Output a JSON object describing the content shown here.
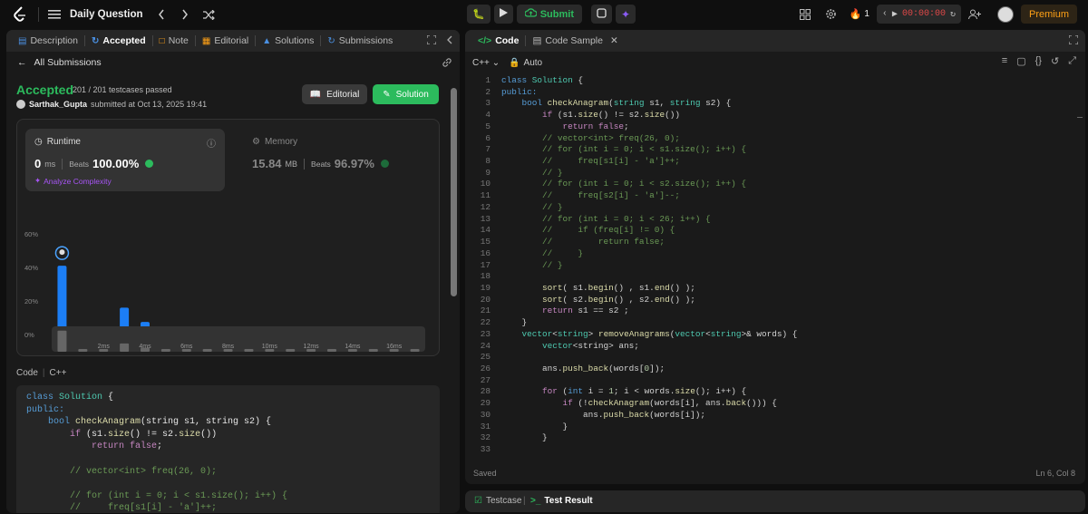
{
  "topbar": {
    "title": "Daily Question",
    "submit": "Submit",
    "streak": "1",
    "timer": "00:00:00",
    "premium": "Premium"
  },
  "left_tabs": [
    {
      "label": "Description",
      "icon": "description-icon",
      "active": false
    },
    {
      "label": "Accepted",
      "icon": "history-icon",
      "active": true
    },
    {
      "label": "Note",
      "icon": "note-icon",
      "active": false
    },
    {
      "label": "Editorial",
      "icon": "book-icon",
      "active": false
    },
    {
      "label": "Solutions",
      "icon": "flask-icon",
      "active": false
    },
    {
      "label": "Submissions",
      "icon": "history-icon",
      "active": false
    }
  ],
  "submission": {
    "back_label": "All Submissions",
    "status": "Accepted",
    "testcases": "201 / 201 testcases passed",
    "user": "Sarthak_Gupta",
    "submitted_at": "submitted at Oct 13, 2025 19:41",
    "editorial_btn": "Editorial",
    "solution_btn": "Solution"
  },
  "runtime": {
    "title": "Runtime",
    "value": "0",
    "unit": "ms",
    "beats_label": "Beats",
    "beats": "100.00%",
    "analyze": "Analyze Complexity"
  },
  "memory": {
    "title": "Memory",
    "value": "15.84",
    "unit": "MB",
    "beats_label": "Beats",
    "beats": "96.97%"
  },
  "chart_data": {
    "type": "bar",
    "title": "",
    "xlabel": "",
    "ylabel": "",
    "ylim": [
      0,
      60
    ],
    "y_ticks": [
      "0%",
      "20%",
      "40%",
      "60%"
    ],
    "x_ticks": [
      "2ms",
      "4ms",
      "6ms",
      "8ms",
      "10ms",
      "12ms",
      "14ms",
      "16ms"
    ],
    "categories": [
      "0ms",
      "1ms",
      "2ms",
      "3ms",
      "4ms",
      "5ms",
      "6ms",
      "7ms",
      "8ms",
      "9ms",
      "10ms",
      "11ms",
      "12ms",
      "13ms",
      "14ms",
      "15ms",
      "16ms",
      "17ms"
    ],
    "values": [
      41,
      4,
      4.5,
      16,
      7.5,
      2,
      2.5,
      4.5,
      1.5,
      1.5,
      1.5,
      1.5,
      1.5,
      1.5,
      1.5,
      1.5,
      1.5,
      1.5
    ],
    "highlight_index": 0,
    "bar_color": "#1c7ef5"
  },
  "code_label": "Code",
  "code_lang": "C++",
  "left_code": [
    [
      {
        "t": "class ",
        "c": "kw"
      },
      {
        "t": "Solution",
        "c": "ty"
      },
      {
        "t": " {",
        "c": ""
      }
    ],
    [
      {
        "t": "public:",
        "c": "kw"
      }
    ],
    [
      {
        "t": "    bool ",
        "c": "kw"
      },
      {
        "t": "checkAnagram",
        "c": "fn"
      },
      {
        "t": "(string s1, string s2) {",
        "c": ""
      }
    ],
    [
      {
        "t": "        if ",
        "c": "cy"
      },
      {
        "t": "(s1.",
        "c": ""
      },
      {
        "t": "size",
        "c": "fn"
      },
      {
        "t": "() != s2.",
        "c": ""
      },
      {
        "t": "size",
        "c": "fn"
      },
      {
        "t": "())",
        "c": ""
      }
    ],
    [
      {
        "t": "            return false",
        "c": "cy"
      },
      {
        "t": ";",
        "c": ""
      }
    ],
    [
      {
        "t": "",
        "c": ""
      }
    ],
    [
      {
        "t": "        // vector<int> freq(26, 0);",
        "c": "cm"
      }
    ],
    [
      {
        "t": "",
        "c": ""
      }
    ],
    [
      {
        "t": "        // for (int i = 0; i < s1.size(); i++) {",
        "c": "cm"
      }
    ],
    [
      {
        "t": "        //     freq[s1[i] - 'a']++;",
        "c": "cm"
      }
    ]
  ],
  "editor": {
    "tab_code": "Code",
    "tab_sample": "Code Sample",
    "lang": "C++",
    "mode": "Auto",
    "saved": "Saved",
    "cursor": "Ln 6, Col 8",
    "lines": [
      [
        {
          "t": "class ",
          "c": "kw"
        },
        {
          "t": "Solution",
          "c": "ty"
        },
        {
          "t": " {",
          "c": ""
        }
      ],
      [
        {
          "t": "public:",
          "c": "kw"
        }
      ],
      [
        {
          "t": "    bool ",
          "c": "kw"
        },
        {
          "t": "checkAnagram",
          "c": "fn"
        },
        {
          "t": "(",
          "c": ""
        },
        {
          "t": "string",
          "c": "ty"
        },
        {
          "t": " s1, ",
          "c": ""
        },
        {
          "t": "string",
          "c": "ty"
        },
        {
          "t": " s2) {",
          "c": ""
        }
      ],
      [
        {
          "t": "        if ",
          "c": "cy"
        },
        {
          "t": "(s1.",
          "c": ""
        },
        {
          "t": "size",
          "c": "fn"
        },
        {
          "t": "() != s2.",
          "c": ""
        },
        {
          "t": "size",
          "c": "fn"
        },
        {
          "t": "())",
          "c": ""
        }
      ],
      [
        {
          "t": "            return false",
          "c": "cy"
        },
        {
          "t": ";",
          "c": ""
        }
      ],
      [
        {
          "t": "        // vector<int> freq(26, 0);",
          "c": "cm"
        }
      ],
      [
        {
          "t": "        // for (int i = 0; i < s1.size(); i++) {",
          "c": "cm"
        }
      ],
      [
        {
          "t": "        //     freq[s1[i] - 'a']++;",
          "c": "cm"
        }
      ],
      [
        {
          "t": "        // }",
          "c": "cm"
        }
      ],
      [
        {
          "t": "        // for (int i = 0; i < s2.size(); i++) {",
          "c": "cm"
        }
      ],
      [
        {
          "t": "        //     freq[s2[i] - 'a']--;",
          "c": "cm"
        }
      ],
      [
        {
          "t": "        // }",
          "c": "cm"
        }
      ],
      [
        {
          "t": "        // for (int i = 0; i < 26; i++) {",
          "c": "cm"
        }
      ],
      [
        {
          "t": "        //     if (freq[i] != 0) {",
          "c": "cm"
        }
      ],
      [
        {
          "t": "        //         return false;",
          "c": "cm"
        }
      ],
      [
        {
          "t": "        //     }",
          "c": "cm"
        }
      ],
      [
        {
          "t": "        // }",
          "c": "cm"
        }
      ],
      [
        {
          "t": "",
          "c": ""
        }
      ],
      [
        {
          "t": "        sort",
          "c": "fn"
        },
        {
          "t": "( s1.",
          "c": ""
        },
        {
          "t": "begin",
          "c": "fn"
        },
        {
          "t": "() , s1.",
          "c": ""
        },
        {
          "t": "end",
          "c": "fn"
        },
        {
          "t": "() );",
          "c": ""
        }
      ],
      [
        {
          "t": "        sort",
          "c": "fn"
        },
        {
          "t": "( s2.",
          "c": ""
        },
        {
          "t": "begin",
          "c": "fn"
        },
        {
          "t": "() , s2.",
          "c": ""
        },
        {
          "t": "end",
          "c": "fn"
        },
        {
          "t": "() );",
          "c": ""
        }
      ],
      [
        {
          "t": "        return ",
          "c": "cy"
        },
        {
          "t": "s1 == s2 ;",
          "c": ""
        }
      ],
      [
        {
          "t": "    }",
          "c": ""
        }
      ],
      [
        {
          "t": "    vector",
          "c": "ty"
        },
        {
          "t": "<",
          "c": ""
        },
        {
          "t": "string",
          "c": "ty"
        },
        {
          "t": "> ",
          "c": ""
        },
        {
          "t": "removeAnagrams",
          "c": "fn"
        },
        {
          "t": "(",
          "c": ""
        },
        {
          "t": "vector",
          "c": "ty"
        },
        {
          "t": "<",
          "c": ""
        },
        {
          "t": "string",
          "c": "ty"
        },
        {
          "t": ">& words) {",
          "c": ""
        }
      ],
      [
        {
          "t": "        vector",
          "c": "ty"
        },
        {
          "t": "<string> ans;",
          "c": ""
        }
      ],
      [
        {
          "t": "",
          "c": ""
        }
      ],
      [
        {
          "t": "        ans.",
          "c": ""
        },
        {
          "t": "push_back",
          "c": "fn"
        },
        {
          "t": "(words[",
          "c": ""
        },
        {
          "t": "0",
          "c": "nm"
        },
        {
          "t": "]);",
          "c": ""
        }
      ],
      [
        {
          "t": "",
          "c": ""
        }
      ],
      [
        {
          "t": "        for ",
          "c": "cy"
        },
        {
          "t": "(",
          "c": ""
        },
        {
          "t": "int ",
          "c": "kw"
        },
        {
          "t": "i = ",
          "c": ""
        },
        {
          "t": "1",
          "c": "nm"
        },
        {
          "t": "; i < words.",
          "c": ""
        },
        {
          "t": "size",
          "c": "fn"
        },
        {
          "t": "(); i++) {",
          "c": ""
        }
      ],
      [
        {
          "t": "            if ",
          "c": "cy"
        },
        {
          "t": "(!",
          "c": ""
        },
        {
          "t": "checkAnagram",
          "c": "fn"
        },
        {
          "t": "(words[i], ans.",
          "c": ""
        },
        {
          "t": "back",
          "c": "fn"
        },
        {
          "t": "())) {",
          "c": ""
        }
      ],
      [
        {
          "t": "                ans.",
          "c": ""
        },
        {
          "t": "push_back",
          "c": "fn"
        },
        {
          "t": "(words[i]);",
          "c": ""
        }
      ],
      [
        {
          "t": "            }",
          "c": ""
        }
      ],
      [
        {
          "t": "        }",
          "c": ""
        }
      ],
      [
        {
          "t": "",
          "c": ""
        }
      ]
    ]
  },
  "bottom": {
    "testcase": "Testcase",
    "test_result": "Test Result"
  }
}
